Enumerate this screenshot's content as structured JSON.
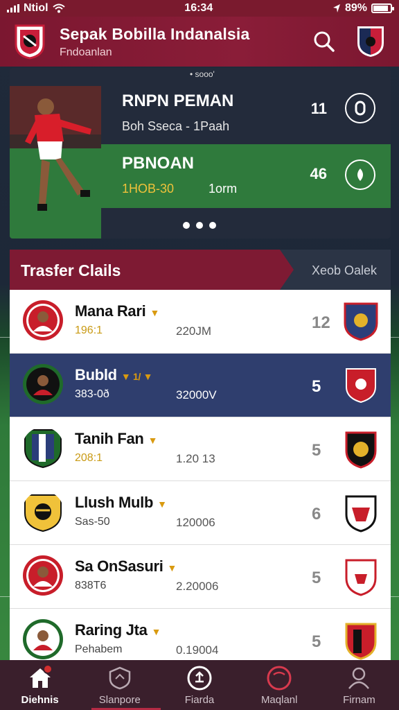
{
  "status_bar": {
    "carrier": "Ntiol",
    "time": "16:34",
    "battery": "89%",
    "battery_level": 0.89
  },
  "header": {
    "title": "Sepak Bobilla Indanalsia",
    "subtitle": "Fndoanlan"
  },
  "featured": {
    "top_indicator": "• sooo'",
    "rows": [
      {
        "title": "RNPN PEMAN",
        "sub": "Boh Sseca - 1Paah",
        "value": "11"
      },
      {
        "title": "PBNOAN",
        "sub_gold": "1HOB-30",
        "sub": "1orm",
        "value": "46"
      }
    ]
  },
  "transfer": {
    "title": "Trasfer Clails",
    "link": "Xeob Oalek",
    "items": [
      {
        "name": "Mana Rari",
        "pos": "196:1",
        "fee": "220JM",
        "count": "12",
        "active": false,
        "gold_pos": true
      },
      {
        "name": "Bubld",
        "rating": "▼ 1/ ▼",
        "pos": "383-0ð",
        "fee": "32000V",
        "count": "5",
        "active": true,
        "gold_pos": false
      },
      {
        "name": "Tanih Fan",
        "pos": "208:1",
        "fee": "1.20 13",
        "count": "5",
        "active": false,
        "gold_pos": true
      },
      {
        "name": "Llush Mulb",
        "pos": "Sas-50",
        "fee": "120006",
        "count": "6",
        "active": false,
        "gold_pos": false
      },
      {
        "name": "Sa OnSasuri",
        "pos": "838T6",
        "fee": "2.20006",
        "count": "5",
        "active": false,
        "gold_pos": false
      },
      {
        "name": "Raring Jta",
        "pos": "Pehabem",
        "fee": "0.19004",
        "count": "5",
        "active": false,
        "gold_pos": false
      }
    ]
  },
  "nav": {
    "items": [
      {
        "label": "Diehnis",
        "icon": "home-icon"
      },
      {
        "label": "Slanpore",
        "icon": "shield-icon"
      },
      {
        "label": "Fiarda",
        "icon": "transfer-icon"
      },
      {
        "label": "Maqlanl",
        "icon": "target-icon"
      },
      {
        "label": "Firnam",
        "icon": "user-icon"
      }
    ]
  },
  "colors": {
    "primary": "#7b1730",
    "active_row": "#2f3e6e",
    "green": "#2f7a3c",
    "gold": "#f0c23a"
  }
}
